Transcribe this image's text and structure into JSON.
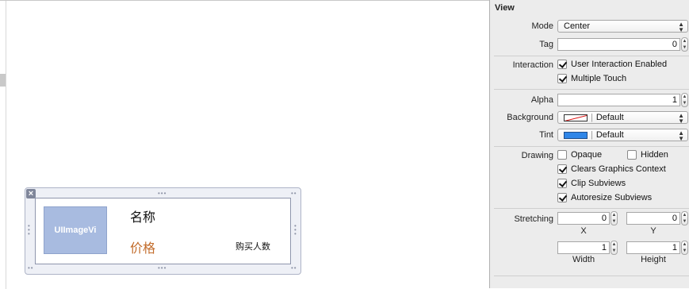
{
  "canvas": {
    "cell": {
      "image_view_label": "UIImageVi",
      "name_label": "名称",
      "price_label": "价格",
      "buyers_label": "购买人数"
    }
  },
  "inspector": {
    "section_title": "View",
    "mode": {
      "label": "Mode",
      "value": "Center"
    },
    "tag": {
      "label": "Tag",
      "value": "0"
    },
    "interaction": {
      "label": "Interaction",
      "user_interaction_enabled": {
        "label": "User Interaction Enabled",
        "checked": true
      },
      "multiple_touch": {
        "label": "Multiple Touch",
        "checked": true
      }
    },
    "alpha": {
      "label": "Alpha",
      "value": "1"
    },
    "background": {
      "label": "Background",
      "value": "Default",
      "swatch": "clear"
    },
    "tint": {
      "label": "Tint",
      "value": "Default",
      "swatch_color": "#2f86e8"
    },
    "drawing": {
      "label": "Drawing",
      "opaque": {
        "label": "Opaque",
        "checked": false
      },
      "hidden": {
        "label": "Hidden",
        "checked": false
      },
      "clears_graphics_context": {
        "label": "Clears Graphics Context",
        "checked": true
      },
      "clip_subviews": {
        "label": "Clip Subviews",
        "checked": true
      },
      "autoresize_subviews": {
        "label": "Autoresize Subviews",
        "checked": true
      }
    },
    "stretching": {
      "label": "Stretching",
      "x": {
        "label": "X",
        "value": "0"
      },
      "y": {
        "label": "Y",
        "value": "0"
      },
      "width": {
        "label": "Width",
        "value": "1"
      },
      "height": {
        "label": "Height",
        "value": "1"
      }
    }
  }
}
